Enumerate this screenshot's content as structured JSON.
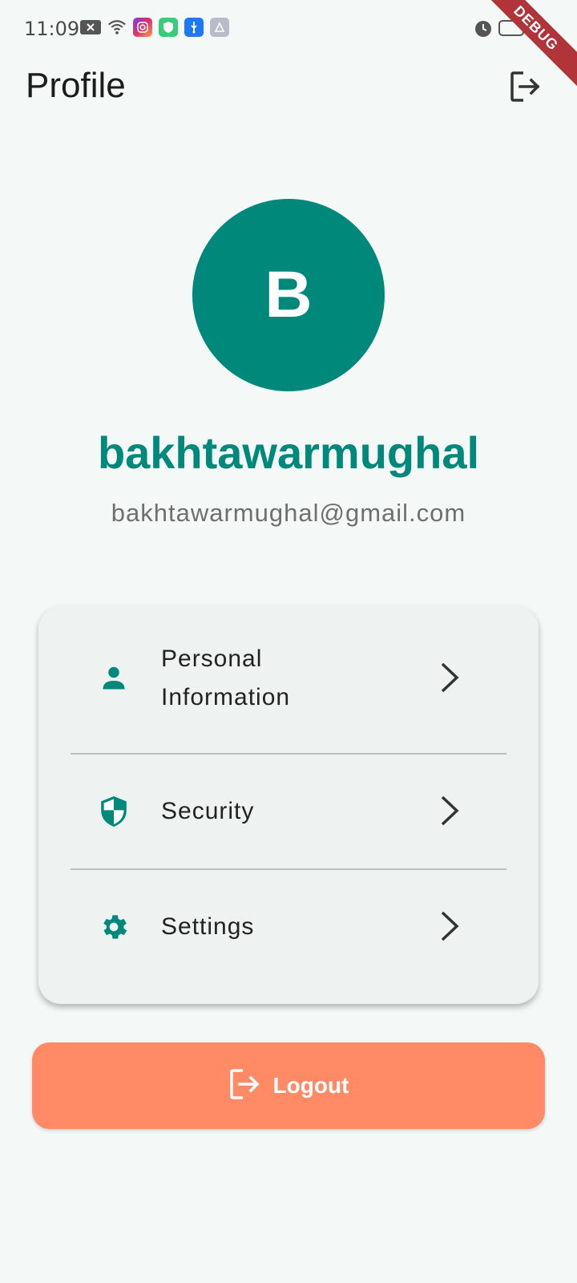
{
  "status_bar": {
    "time": "11:09",
    "left_icons": [
      "notification-x-icon",
      "wifi-icon",
      "instagram-icon",
      "vpn-shield-icon",
      "usb-icon",
      "app-icon"
    ],
    "right_icons": [
      "alarm-icon",
      "battery-icon",
      "charging-icon"
    ],
    "debug_label": "DEBUG"
  },
  "app_bar": {
    "title": "Profile",
    "action_icon": "logout-icon"
  },
  "profile": {
    "avatar_letter": "B",
    "username": "bakhtawarmughal",
    "email": "bakhtawarmughal@gmail.com"
  },
  "menu": {
    "items": [
      {
        "label_line1": "Personal",
        "label_line2": "Information",
        "icon": "person-icon"
      },
      {
        "label": "Security",
        "icon": "shield-icon"
      },
      {
        "label": "Settings",
        "icon": "gear-icon"
      }
    ]
  },
  "logout_button": {
    "label": "Logout",
    "icon": "logout-icon"
  },
  "colors": {
    "accent": "#00897B",
    "background": "#F4F8F7",
    "card": "#EEF3F1",
    "logout": "#FF8A65"
  }
}
